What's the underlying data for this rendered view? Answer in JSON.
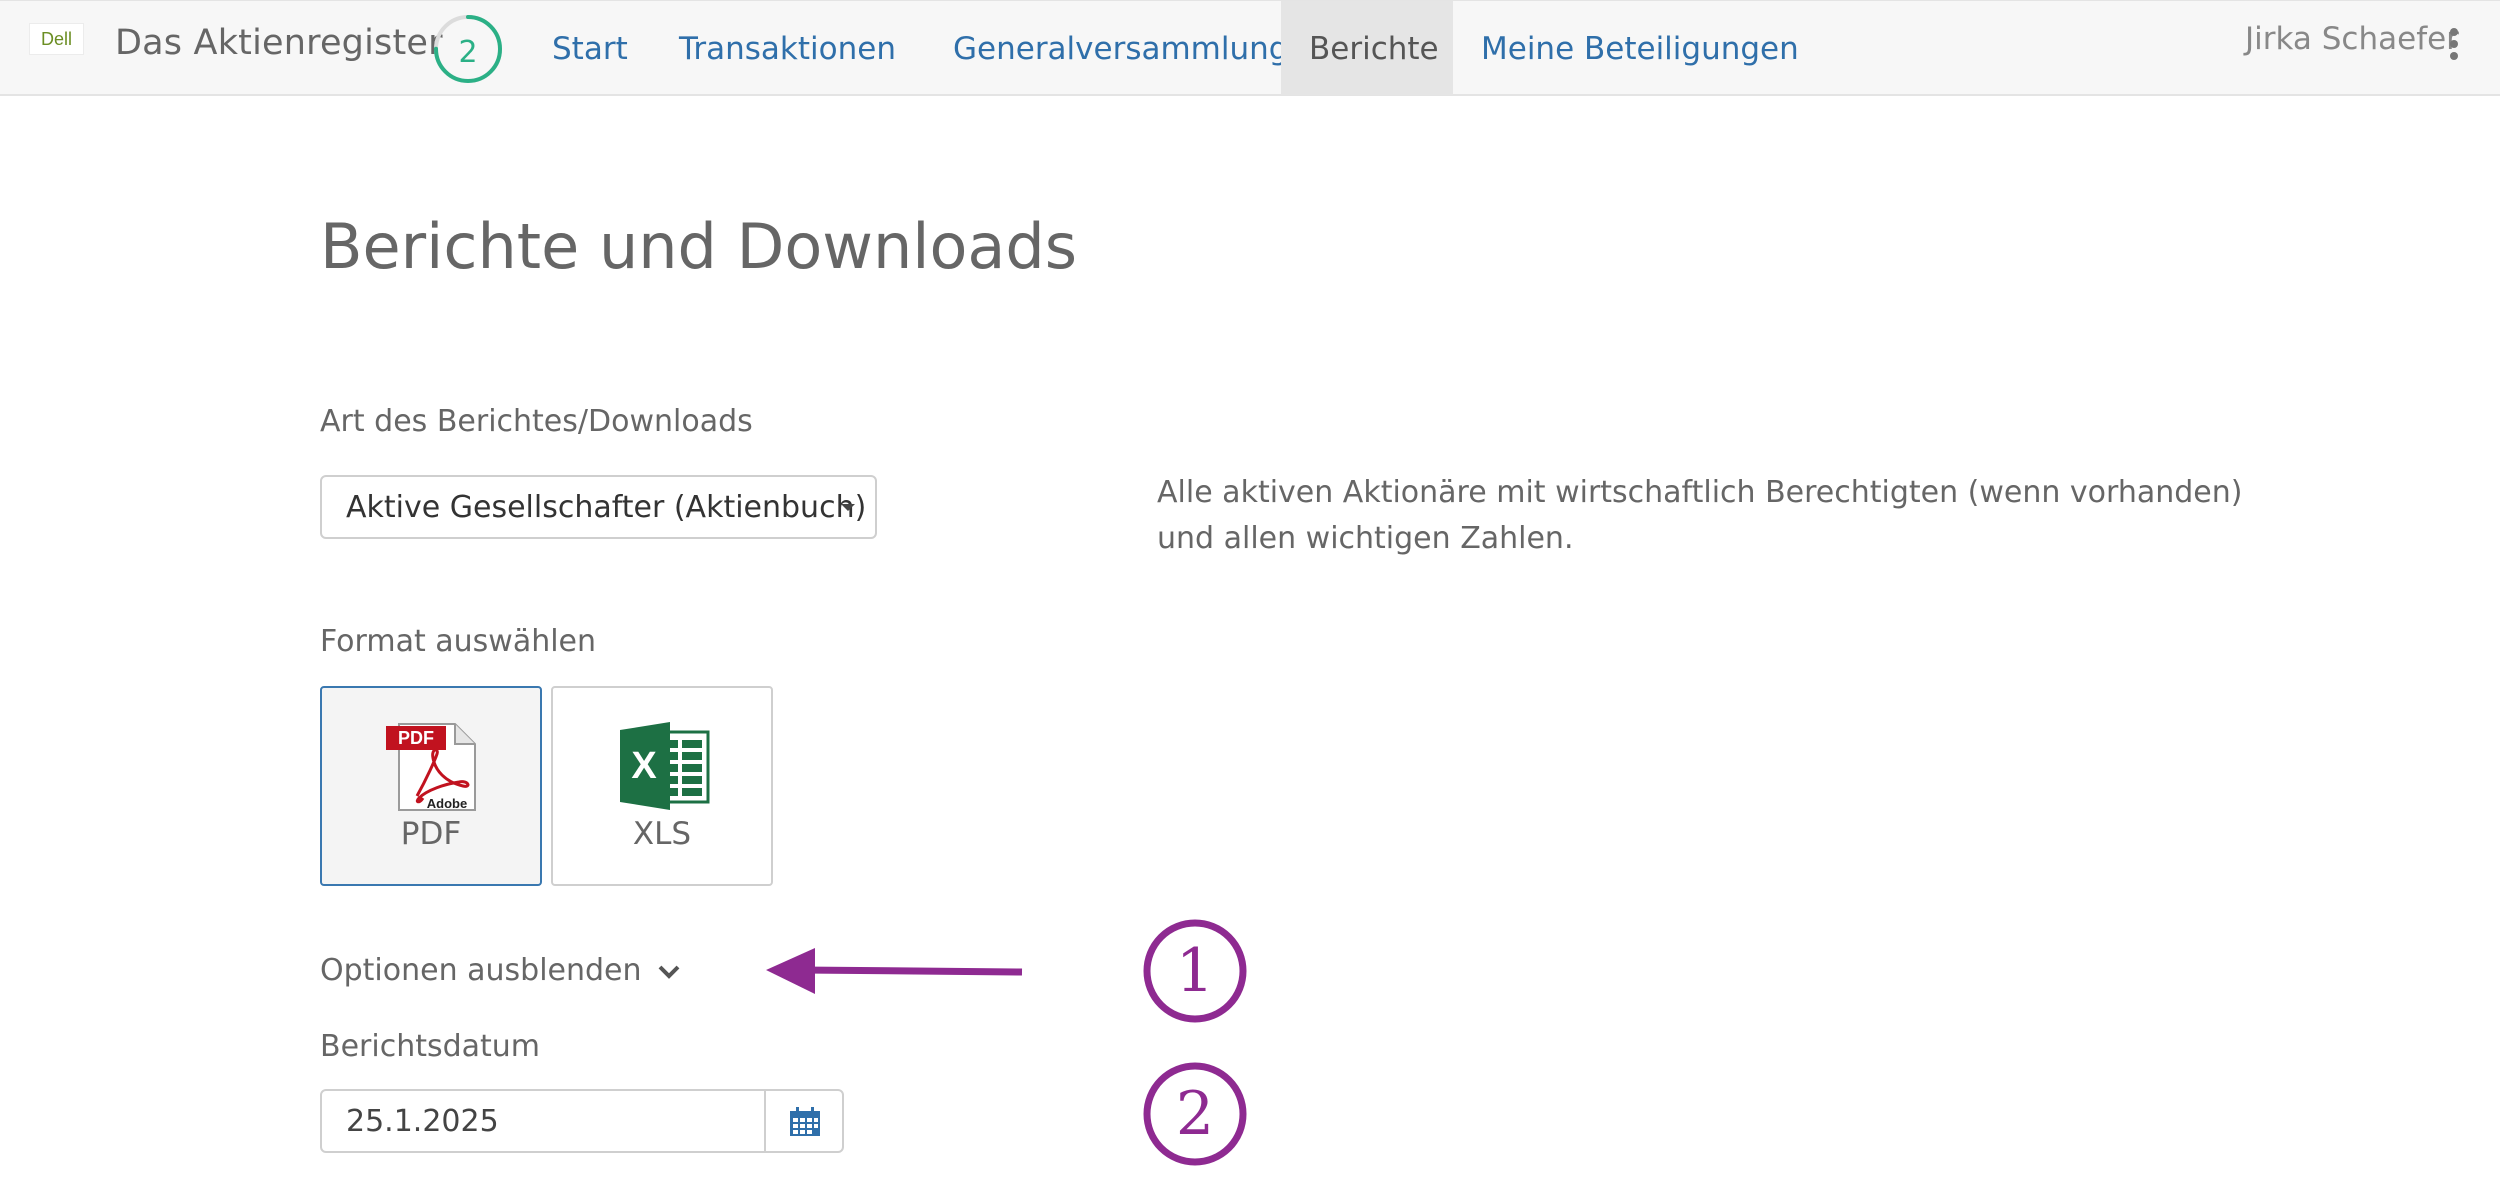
{
  "navbar": {
    "logo_text": "Dell",
    "app_title": "Das Aktienregister",
    "progress_number": "2",
    "progress_fraction": 0.75,
    "items": [
      {
        "label": "Start"
      },
      {
        "label": "Transaktionen"
      },
      {
        "label": "Generalversammlung"
      },
      {
        "label": "Berichte",
        "active": true
      },
      {
        "label": "Meine Beteiligungen"
      }
    ],
    "user_name": "Jirka Schaefer"
  },
  "main": {
    "title": "Berichte und Downloads",
    "report_type_label": "Art des Berichtes/Downloads",
    "report_type_selected": "Aktive Gesellschafter (Aktienbuch)",
    "description": "Alle aktiven Aktionäre mit wirtschaftlich Berechtigten (wenn vorhanden) und allen wichtigen Zahlen.",
    "format_label": "Format auswählen",
    "formats": [
      {
        "label": "PDF",
        "icon": "pdf-icon",
        "selected": true
      },
      {
        "label": "XLS",
        "icon": "excel-icon",
        "selected": false
      }
    ],
    "options_toggle": "Optionen ausblenden",
    "report_date_label": "Berichtsdatum",
    "report_date_value": "25.1.2025"
  },
  "annotations": {
    "markers": [
      "1",
      "2"
    ],
    "color": "#8e2a91"
  },
  "colors": {
    "link": "#2f6faa",
    "progress": "#2bb086",
    "selected_border": "#3a78b0",
    "pdf_red": "#c1121f",
    "excel_green": "#1d7044"
  }
}
